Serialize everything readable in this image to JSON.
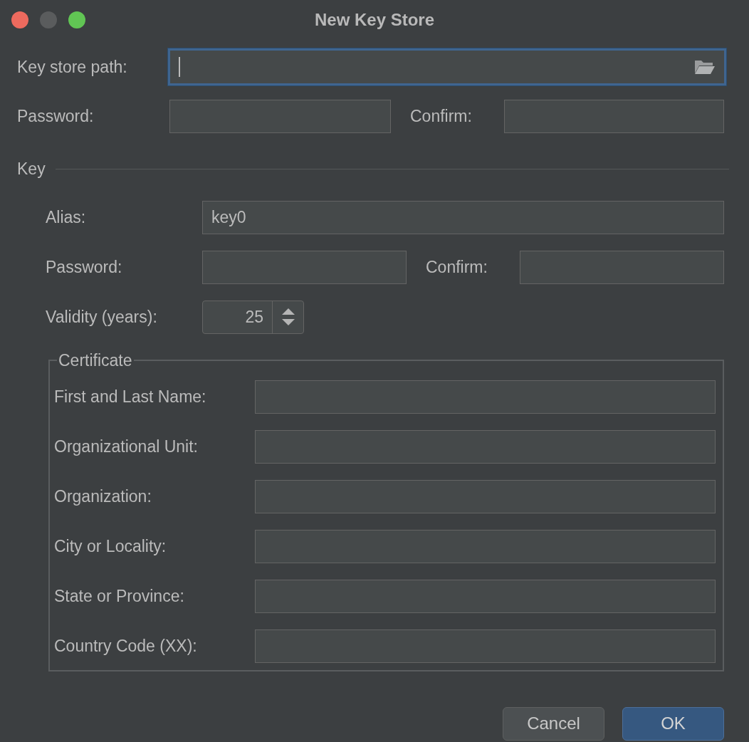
{
  "window": {
    "title": "New Key Store"
  },
  "key_store": {
    "path": {
      "label": "Key store path:",
      "focused": true
    },
    "password": {
      "label": "Password:"
    },
    "confirm": {
      "label": "Confirm:"
    }
  },
  "key": {
    "title": "Key",
    "alias": {
      "label": "Alias:",
      "value": "key0"
    },
    "password": {
      "label": "Password:"
    },
    "confirm": {
      "label": "Confirm:"
    },
    "validity": {
      "label": "Validity (years):",
      "value": "25"
    },
    "certificate": {
      "title": "Certificate",
      "fields": [
        {
          "label": "First and Last Name:"
        },
        {
          "label": "Organizational Unit:"
        },
        {
          "label": "Organization:"
        },
        {
          "label": "City or Locality:"
        },
        {
          "label": "State or Province:"
        },
        {
          "label": "Country Code (XX):"
        }
      ]
    }
  },
  "buttons": [
    {
      "label": "Cancel",
      "default": false
    },
    {
      "label": "OK",
      "default": true
    }
  ]
}
